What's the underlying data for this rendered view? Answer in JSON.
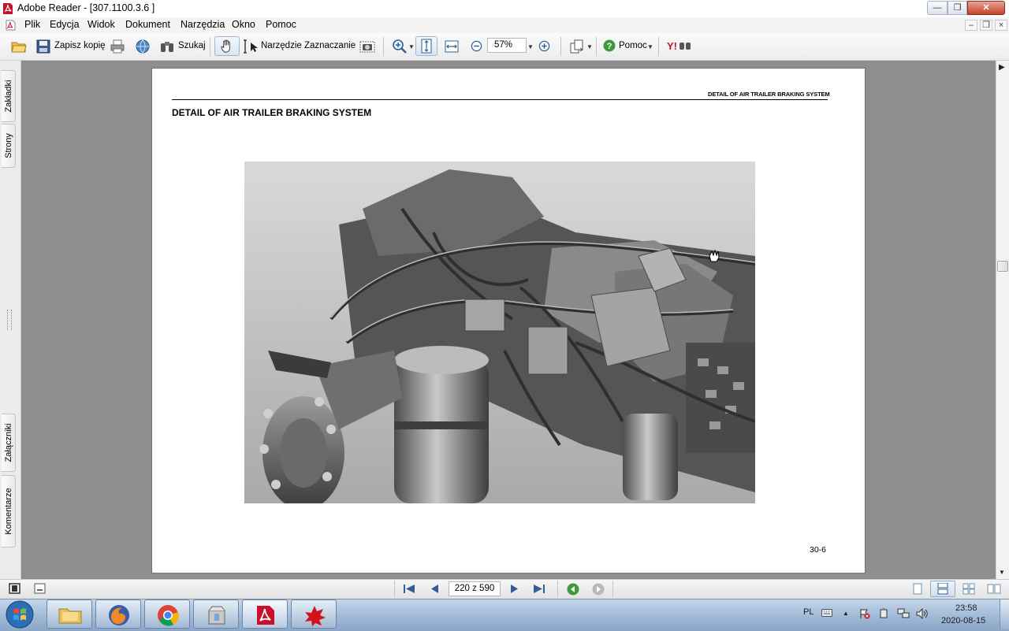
{
  "window": {
    "title": "Adobe Reader - [307.1100.3.6 ]",
    "controls": [
      "minimize",
      "maximize",
      "close"
    ]
  },
  "menu": {
    "items": [
      "Plik",
      "Edycja",
      "Widok",
      "Dokument",
      "Narzędzia",
      "Okno",
      "Pomoc"
    ]
  },
  "toolbar": {
    "save_copy": "Zapisz kopię",
    "search": "Szukaj",
    "select_tool": "Narzędzie Zaznaczanie",
    "zoom": "57%",
    "help": "Pomoc"
  },
  "left_panel": {
    "tabs": [
      "Zakładki",
      "Strony",
      "Załączniki",
      "Komentarze"
    ]
  },
  "document": {
    "running_header": "DETAIL OF AIR TRAILER BRAKING SYSTEM",
    "section_title": "DETAIL OF AIR TRAILER BRAKING SYSTEM",
    "page_number": "30-6"
  },
  "navigation": {
    "page_indicator": "220 z 590"
  },
  "taskbar": {
    "language": "PL",
    "time": "23:58",
    "date": "2020-08-15"
  },
  "colors": {
    "accent_blue": "#2b6cb0",
    "doc_background": "#8e8e8e",
    "acrobat_red": "#c8102e"
  }
}
